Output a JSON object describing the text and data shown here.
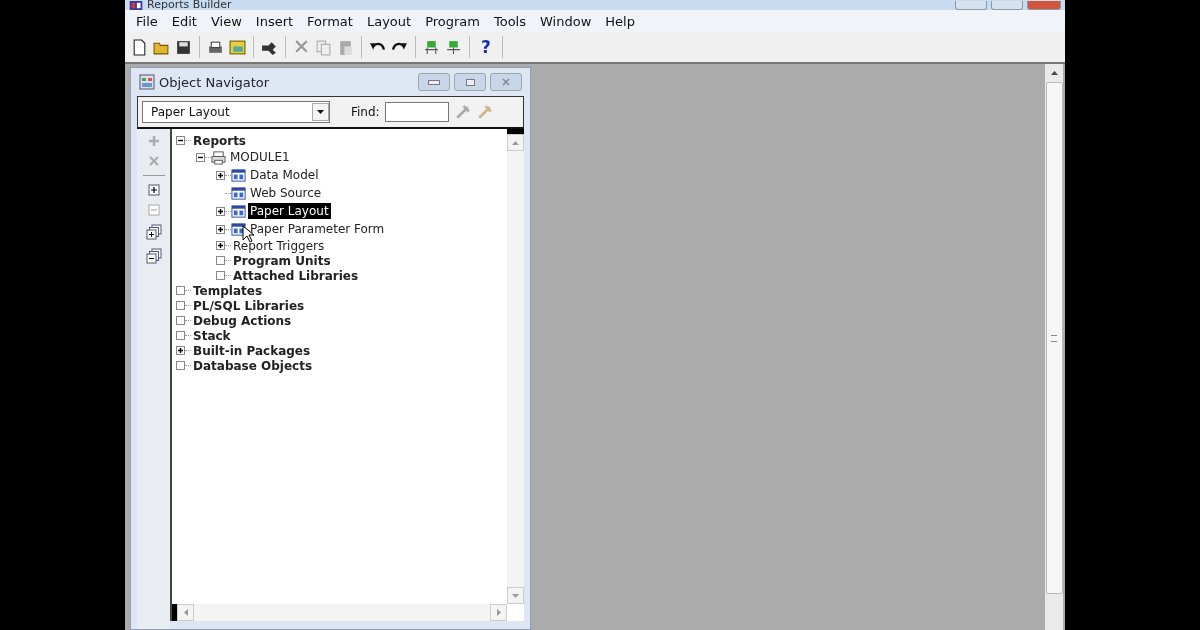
{
  "app": {
    "title": "Reports Builder"
  },
  "menu": [
    {
      "label": "File"
    },
    {
      "label": "Edit"
    },
    {
      "label": "View"
    },
    {
      "label": "Insert"
    },
    {
      "label": "Format"
    },
    {
      "label": "Layout"
    },
    {
      "label": "Program"
    },
    {
      "label": "Tools"
    },
    {
      "label": "Window"
    },
    {
      "label": "Help"
    }
  ],
  "toolbar": {
    "help_label": "?"
  },
  "navigator": {
    "title": "Object Navigator",
    "view": {
      "value": "Paper Layout"
    },
    "find": {
      "label": "Find:"
    },
    "tree": [
      {
        "label": "Reports",
        "kind": "category",
        "expanded": true,
        "selected": false,
        "children": [
          {
            "label": "MODULE1",
            "kind": "module",
            "expanded": true,
            "selected": false,
            "children": [
              {
                "label": "Data Model",
                "kind": "object",
                "expanded": false,
                "selected": false
              },
              {
                "label": "Web Source",
                "kind": "object",
                "toggle": false,
                "selected": false
              },
              {
                "label": "Paper Layout",
                "kind": "object",
                "expanded": false,
                "selected": true
              },
              {
                "label": "Paper Parameter Form",
                "kind": "object",
                "expanded": false,
                "selected": false
              },
              {
                "label": "Report Triggers",
                "kind": "group",
                "expanded": false,
                "selected": false
              },
              {
                "label": "Program Units",
                "kind": "category",
                "selected": false
              },
              {
                "label": "Attached Libraries",
                "kind": "category",
                "selected": false
              }
            ]
          }
        ]
      },
      {
        "label": "Templates",
        "kind": "category",
        "selected": false
      },
      {
        "label": "PL/SQL Libraries",
        "kind": "category",
        "selected": false
      },
      {
        "label": "Debug Actions",
        "kind": "category",
        "selected": false
      },
      {
        "label": "Stack",
        "kind": "category",
        "selected": false
      },
      {
        "label": "Built-in Packages",
        "kind": "category",
        "expanded": false,
        "selected": false
      },
      {
        "label": "Database Objects",
        "kind": "category",
        "selected": false
      }
    ]
  }
}
